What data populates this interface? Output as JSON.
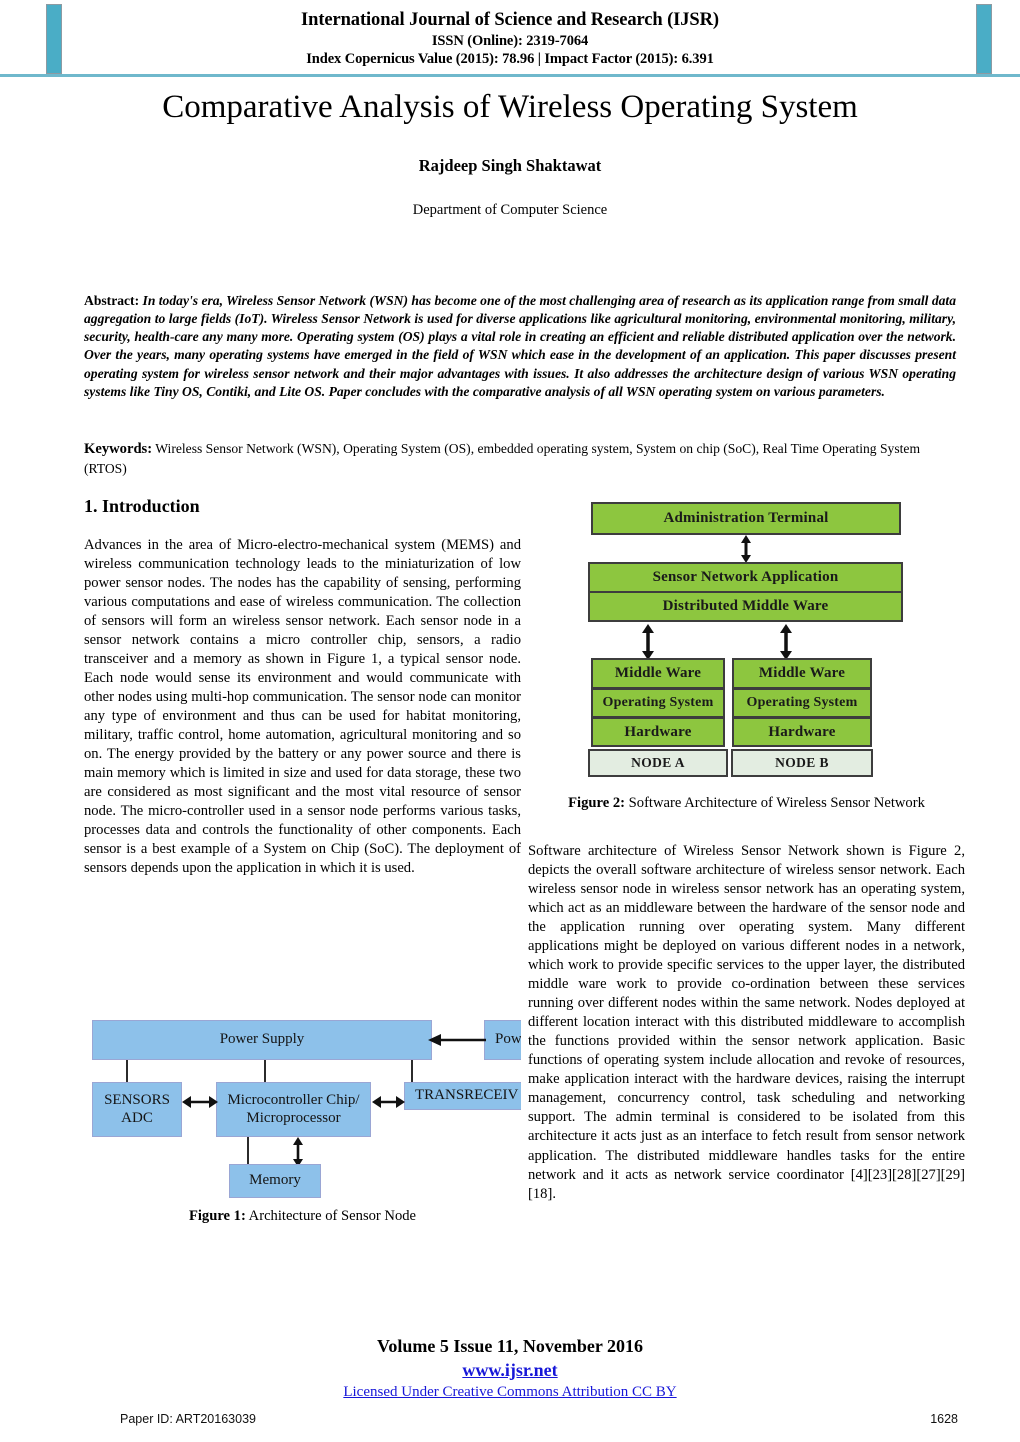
{
  "header": {
    "journal_title": "International Journal of Science and Research (IJSR)",
    "issn": "ISSN (Online): 2319-7064",
    "metrics": "Index Copernicus Value (2015): 78.96 | Impact Factor (2015): 6.391",
    "accent_color": "#4aadc6",
    "rule_color": "#6fb8cc"
  },
  "title_block": {
    "title": "Comparative Analysis of Wireless Operating System",
    "author": "Rajdeep Singh Shaktawat",
    "affiliation": "Department of Computer Science"
  },
  "abstract": {
    "label": "Abstract:",
    "text": " In today's era, Wireless Sensor Network (WSN) has become one of the most challenging area of research as its application range from small data aggregation to large fields (IoT).  Wireless Sensor Network is used for diverse applications like agricultural monitoring, environmental monitoring, military, security, health-care any many more. Operating system (OS) plays a vital role in creating an efficient and reliable distributed application over the network.  Over the years, many operating systems have emerged in the field of WSN which ease in the development of an application. This paper discusses present operating system for wireless sensor network and their major advantages with issues. It also addresses the architecture design of various WSN operating systems like Tiny OS, Contiki, and Lite OS. Paper concludes with the comparative analysis of all WSN operating system on various parameters."
  },
  "keywords": {
    "label": "Keywords:",
    "text": " Wireless Sensor Network (WSN), Operating System (OS), embedded operating system, System on chip (SoC), Real Time Operating System (RTOS)"
  },
  "left_column": {
    "section_heading": "1. Introduction",
    "paragraph_1": "Advances in the area of Micro-electro-mechanical system (MEMS) and wireless communication technology leads to the miniaturization of low power sensor nodes. The nodes has the capability of sensing, performing various computations and ease of wireless communication. The collection of sensors will form an wireless sensor network. Each sensor node in a sensor network contains a micro controller chip, sensors, a radio transceiver and a memory as shown in Figure 1, a typical sensor node. Each node would sense its environment and would communicate with other nodes using multi-hop communication. The sensor node can monitor any type of environment and thus can be used for habitat monitoring, military, traffic control, home automation, agricultural monitoring and so on. The energy provided by the battery or any power source and there is main memory which is limited in size and used for data storage, these two are considered as most significant and the most vital resource of sensor node. The micro-controller used in a sensor node performs various tasks, processes data and controls the functionality of other components. Each sensor is a best example of a System on Chip (SoC). The deployment of sensors depends upon the application in which it is used."
  },
  "right_column": {
    "paragraph_1": "Software architecture of Wireless Sensor Network shown is Figure 2, depicts the overall software architecture of wireless sensor network. Each wireless sensor node in wireless sensor network has an operating system, which act as an middleware between the hardware of the sensor node and the application running over operating system. Many different applications might be deployed on various different nodes in a network, which work to provide specific services to the upper layer, the distributed middle ware work to provide co-ordination between these services running over different nodes within the same network. Nodes deployed at different location interact with this distributed middleware to accomplish the functions provided within the sensor network application. Basic functions of operating system include allocation and revoke of resources, make application interact with the hardware devices, raising the interrupt management, concurrency control, task scheduling and networking support. The admin terminal is considered to be isolated from this architecture it acts just as an interface to fetch result from sensor network application.  The distributed middleware handles tasks for the entire network and it acts as network service coordinator [4][23][28][27][29][18]."
  },
  "figure1": {
    "caption_label": "Figure 1:",
    "caption_text": " Architecture of Sensor Node",
    "box_color": "#8dc1ea",
    "border_color": "#9aa6d4",
    "boxes": {
      "power_supply": "Power Supply",
      "power_generator": "Power G",
      "sensors": "SENSORS\nADC",
      "microcontroller": "Microcontroller Chip/\nMicroprocessor",
      "transreceiver": "TRANSRECEIV",
      "memory": "Memory"
    }
  },
  "figure2": {
    "caption_label": "Figure 2:",
    "caption_text": " Software Architecture of Wireless Sensor Network",
    "box_color": "#8dc63f",
    "node_box_color": "#e3ede1",
    "border_color": "#3d3d3d",
    "boxes": {
      "admin_terminal": "Administration Terminal",
      "sensor_network_application": "Sensor Network Application",
      "distributed_middleware": "Distributed Middle Ware",
      "node_a_middleware": "Middle Ware",
      "node_a_os": "Operating System",
      "node_a_hardware": "Hardware",
      "node_a_label": "NODE A",
      "node_b_middleware": "Middle Ware",
      "node_b_os": "Operating System",
      "node_b_hardware": "Hardware",
      "node_b_label": "NODE B"
    }
  },
  "footer": {
    "volume": "Volume 5 Issue 11, November 2016",
    "website": "www.ijsr.net",
    "license": "Licensed Under Creative Commons Attribution CC BY",
    "paper_id": "Paper ID: ART20163039",
    "page_number": "1628",
    "link_color": "#1616d8"
  }
}
